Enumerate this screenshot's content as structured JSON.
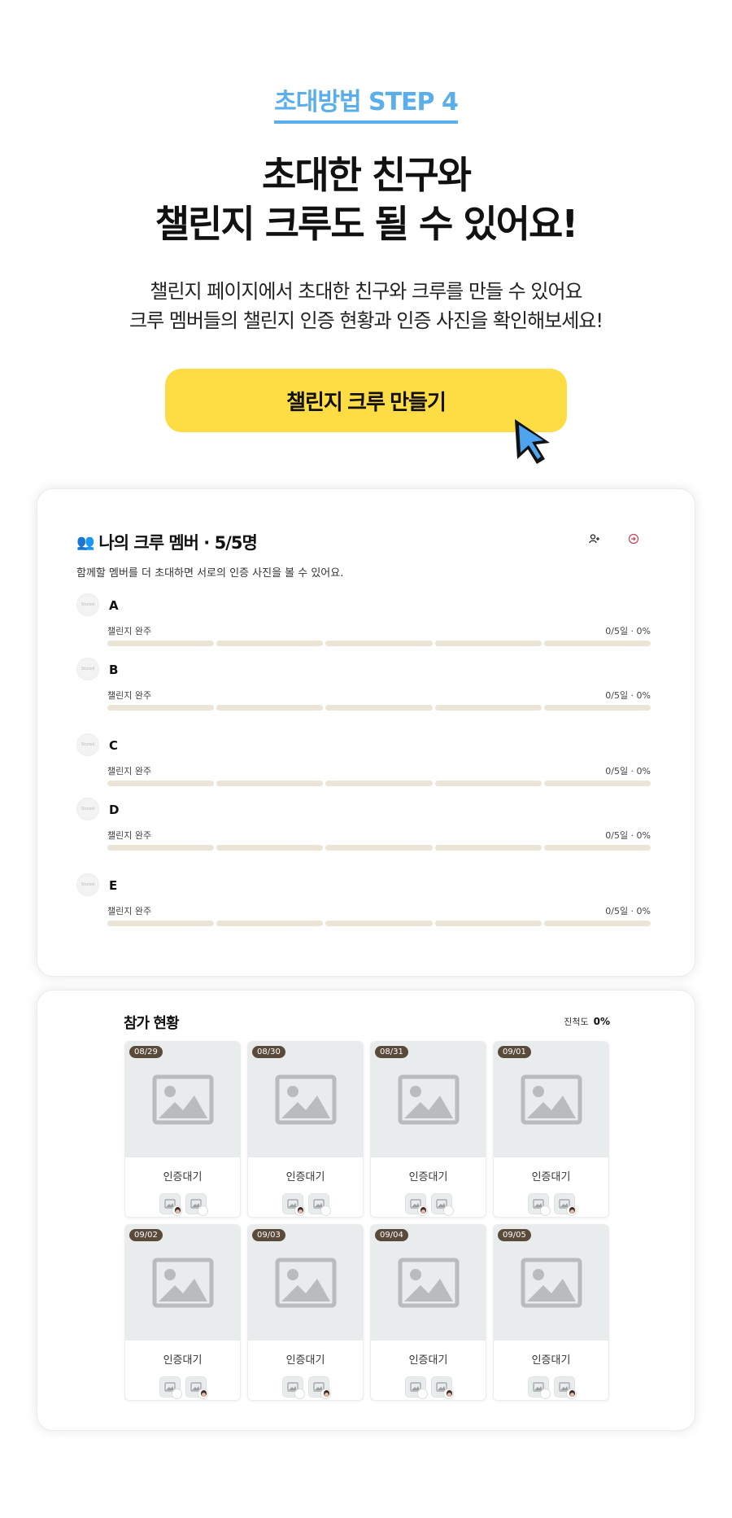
{
  "step": {
    "label": "초대방법 STEP 4"
  },
  "headline": {
    "line1": "초대한 친구와",
    "line2": "챌린지 크루도 될 수 있어요!"
  },
  "description": {
    "line1": "챌린지 페이지에서 초대한 친구와 크루를 만들 수 있어요",
    "line2": "크루 멤버들의 챌린지 인증 현황과 인증 사진을 확인해보세요!"
  },
  "cta": {
    "label": "챌린지 크루 만들기"
  },
  "crew": {
    "emoji": "👥",
    "title": "나의 크루 멤버 · 5/5명",
    "subtitle": "함께할 멤버를 더 초대하면 서로의 인증 사진을 볼 수 있어요.",
    "avatar_text": "Stored",
    "members": [
      {
        "name": "A",
        "label": "챌린지 완주",
        "progress": "0/5일 · 0%"
      },
      {
        "name": "B",
        "label": "챌린지 완주",
        "progress": "0/5일 · 0%"
      },
      {
        "name": "C",
        "label": "챌린지 완주",
        "progress": "0/5일 · 0%"
      },
      {
        "name": "D",
        "label": "챌린지 완주",
        "progress": "0/5일 · 0%"
      },
      {
        "name": "E",
        "label": "챌린지 완주",
        "progress": "0/5일 · 0%"
      }
    ]
  },
  "participation": {
    "title": "참가 현황",
    "progress_label": "진척도",
    "progress_value": "0%",
    "days": [
      {
        "date": "08/29",
        "status": "인증대기"
      },
      {
        "date": "08/30",
        "status": "인증대기"
      },
      {
        "date": "08/31",
        "status": "인증대기"
      },
      {
        "date": "09/01",
        "status": "인증대기"
      },
      {
        "date": "09/02",
        "status": "인증대기"
      },
      {
        "date": "09/03",
        "status": "인증대기"
      },
      {
        "date": "09/04",
        "status": "인증대기"
      },
      {
        "date": "09/05",
        "status": "인증대기"
      }
    ]
  },
  "colors": {
    "accent_blue": "#5aaeea",
    "cta_yellow": "#fddc44",
    "bar_beige": "#ece4d6",
    "date_badge": "#5a4a3a"
  }
}
